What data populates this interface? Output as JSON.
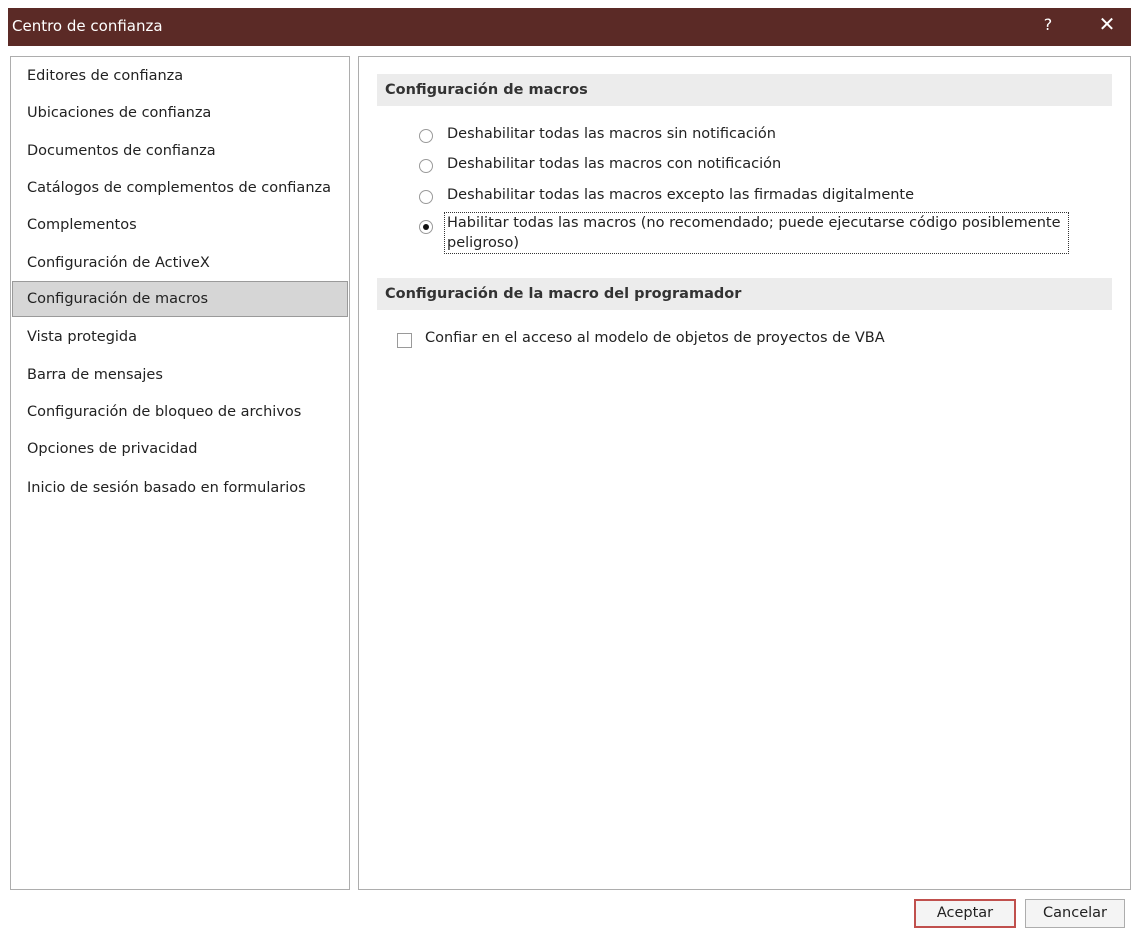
{
  "window": {
    "title": "Centro de confianza",
    "help_glyph": "?",
    "close_glyph": "✕"
  },
  "sidebar": {
    "items": [
      {
        "label": "Editores de confianza"
      },
      {
        "label": "Ubicaciones de confianza"
      },
      {
        "label": "Documentos de confianza"
      },
      {
        "label": "Catálogos de complementos de confianza"
      },
      {
        "label": "Complementos"
      },
      {
        "label": "Configuración de ActiveX"
      },
      {
        "label": "Configuración de macros",
        "selected": true
      },
      {
        "label": "Vista protegida"
      },
      {
        "label": "Barra de mensajes"
      },
      {
        "label": "Configuración de bloqueo de archivos"
      },
      {
        "label": "Opciones de privacidad"
      },
      {
        "label": "Inicio de sesión basado en formularios"
      }
    ]
  },
  "macro_settings": {
    "header": "Configuración de macros",
    "options": [
      {
        "label": "Deshabilitar todas las macros sin notificación",
        "checked": false
      },
      {
        "label": "Deshabilitar todas las macros con notificación",
        "checked": false
      },
      {
        "label": "Deshabilitar todas las macros excepto las firmadas digitalmente",
        "checked": false
      },
      {
        "label": "Habilitar todas las macros (no recomendado; puede ejecutarse código posiblemente peligroso)",
        "checked": true
      }
    ]
  },
  "developer_settings": {
    "header": "Configuración de la macro del programador",
    "vba_trust_label": "Confiar en el acceso al modelo de objetos de proyectos de VBA",
    "vba_trust_checked": false
  },
  "buttons": {
    "ok": "Aceptar",
    "cancel": "Cancelar"
  },
  "colors": {
    "titlebar": "#5b2a26",
    "selected_item": "#d6d6d6",
    "ok_border": "#c0504d"
  }
}
